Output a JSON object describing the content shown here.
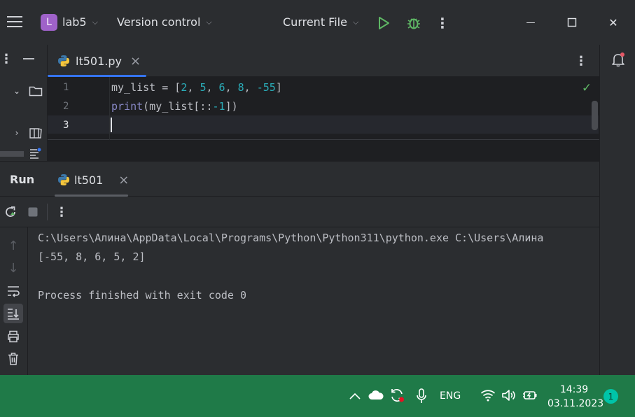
{
  "titlebar": {
    "project_initial": "L",
    "project_name": "lab5",
    "vcs_label": "Version control",
    "run_config": "Current File",
    "menu_glyph": "⋮",
    "win_minimize": "—",
    "win_close": "✕"
  },
  "editor": {
    "tab_label": "lt501.py",
    "tab_close": "×",
    "line_numbers": [
      "1",
      "2",
      "3"
    ],
    "line1": {
      "a": "my_list = [",
      "n1": "2",
      "c1": ", ",
      "n2": "5",
      "c2": ", ",
      "n3": "6",
      "c3": ", ",
      "n4": "8",
      "c4": ", ",
      "n5": "-55",
      "end": "]"
    },
    "line2": {
      "fn": "print",
      "a": "(my_list[::",
      "n": "-1",
      "end": "])"
    },
    "inspection_ok": "✓"
  },
  "run_panel": {
    "title": "Run",
    "tab_label": "lt501",
    "tab_close": "×",
    "menu_glyph": "⋮"
  },
  "console": {
    "lines": [
      "C:\\Users\\Алина\\AppData\\Local\\Programs\\Python\\Python311\\python.exe C:\\Users\\Алина",
      "[-55, 8, 6, 5, 2]",
      "",
      "Process finished with exit code 0"
    ]
  },
  "taskbar": {
    "language": "ENG",
    "time": "14:39",
    "date": "03.11.2023",
    "notification_count": "1"
  },
  "colors": {
    "accent": "#3574f0",
    "project_badge": "#9f62c9",
    "run_green": "#5fb865",
    "taskbar": "#1f7a48"
  }
}
